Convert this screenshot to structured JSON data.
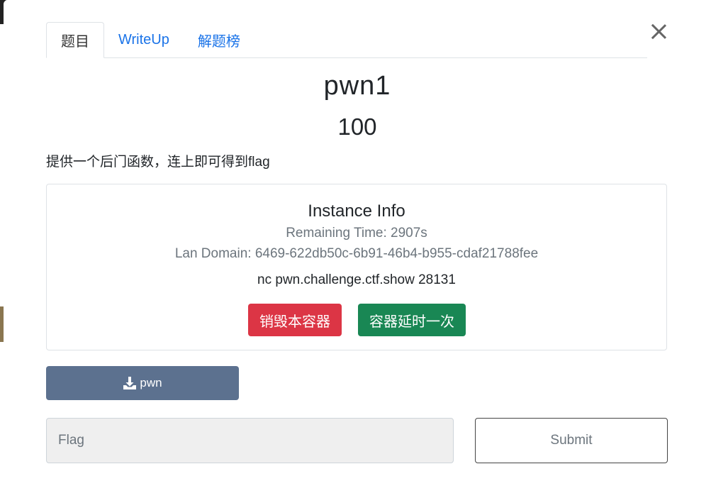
{
  "tabs": [
    {
      "label": "题目",
      "active": true
    },
    {
      "label": "WriteUp",
      "active": false
    },
    {
      "label": "解题榜",
      "active": false
    }
  ],
  "challenge": {
    "name": "pwn1",
    "points": "100",
    "description": "提供一个后门函数，连上即可得到flag"
  },
  "instance": {
    "title": "Instance Info",
    "remaining": "Remaining Time: 2907s",
    "lan_domain": "Lan Domain: 6469-622db50c-6b91-46b4-b955-cdaf21788fee",
    "nc": "nc pwn.challenge.ctf.show 28131",
    "destroy_label": "销毁本容器",
    "extend_label": "容器延时一次"
  },
  "download": {
    "label": "pwn",
    "icon": "download-icon"
  },
  "flag_form": {
    "placeholder": "Flag",
    "value": "",
    "submit_label": "Submit"
  },
  "colors": {
    "tab_link": "#1a73e8",
    "destroy": "#dc3545",
    "extend": "#198754",
    "download": "#5c718f"
  }
}
